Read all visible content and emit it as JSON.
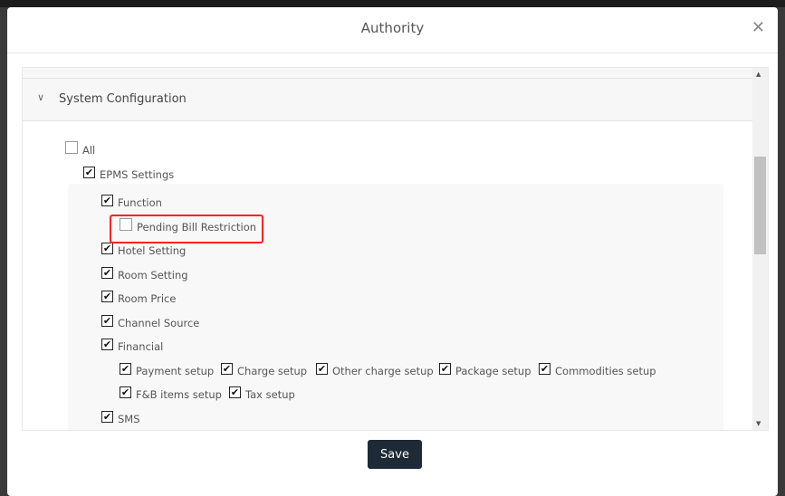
{
  "dialog": {
    "title": "Authority",
    "close_icon": "close-icon"
  },
  "section": {
    "title": "System Configuration",
    "expanded": true
  },
  "tree": [
    {
      "label": "All",
      "checked": false,
      "level": 0
    },
    {
      "label": "EPMS Settings",
      "checked": true,
      "level": 1
    },
    {
      "label": "Function",
      "checked": true,
      "level": 2
    },
    {
      "label": "Pending Bill Restriction",
      "checked": false,
      "level": 3,
      "highlighted": true
    },
    {
      "label": "Hotel Setting",
      "checked": true,
      "level": 2
    },
    {
      "label": "Room Setting",
      "checked": true,
      "level": 2
    },
    {
      "label": "Room Price",
      "checked": true,
      "level": 2
    },
    {
      "label": "Channel Source",
      "checked": true,
      "level": 2
    },
    {
      "label": "Financial",
      "checked": true,
      "level": 2
    },
    {
      "label": "Payment setup",
      "checked": true,
      "level": 3
    },
    {
      "label": "Charge setup",
      "checked": true,
      "level": 3
    },
    {
      "label": "Other charge setup",
      "checked": true,
      "level": 3
    },
    {
      "label": "Package setup",
      "checked": true,
      "level": 3
    },
    {
      "label": "Commodities setup",
      "checked": true,
      "level": 3
    },
    {
      "label": "F&B items setup",
      "checked": true,
      "level": 3
    },
    {
      "label": "Tax setup",
      "checked": true,
      "level": 3
    },
    {
      "label": "SMS",
      "checked": true,
      "level": 2
    }
  ],
  "footer": {
    "save_label": "Save"
  },
  "colors": {
    "highlight": "#ff2222",
    "save_button": "#1e2a35"
  }
}
